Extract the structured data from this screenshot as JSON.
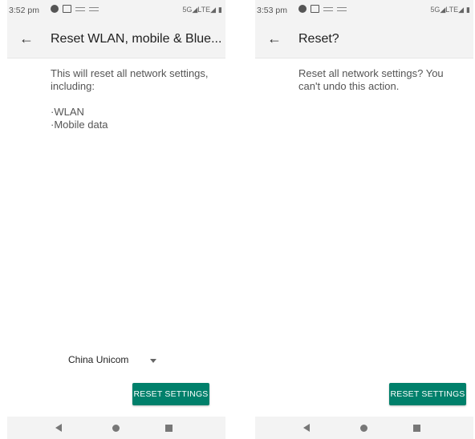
{
  "left": {
    "status_time": "3:52 pm",
    "status_right": "5G◢LTE◢",
    "title": "Reset WLAN, mobile & Blue...",
    "description": "This will reset all network settings, including:",
    "bullets": [
      "·WLAN",
      "·Mobile data"
    ],
    "carrier": "China Unicom",
    "reset_label": "RESET SETTINGS"
  },
  "right": {
    "status_time": "3:53 pm",
    "status_right": "5G◢LTE◢",
    "title": "Reset?",
    "description": "Reset all network settings? You can't undo this action.",
    "reset_label": "RESET SETTINGS"
  },
  "icons": {
    "back": "arrow-left",
    "nav": [
      "triangle-back",
      "circle-home",
      "square-recents"
    ]
  },
  "colors": {
    "accent": "#00806b",
    "bar": "#f3f3f3",
    "text": "#555555"
  }
}
